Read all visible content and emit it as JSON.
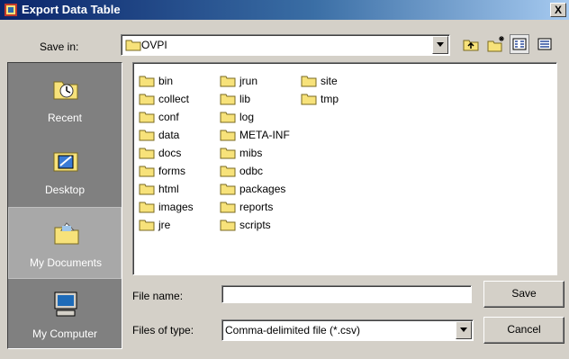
{
  "window": {
    "title": "Export Data Table",
    "close_label": "X"
  },
  "save_in": {
    "label": "Save in:",
    "value": "OVPI"
  },
  "toolbar": {
    "icons": [
      "up-one-level-icon",
      "create-new-folder-icon",
      "list-view-icon",
      "details-view-icon"
    ]
  },
  "places": [
    {
      "label": "Recent",
      "icon": "recent-clock-folder-icon"
    },
    {
      "label": "Desktop",
      "icon": "desktop-icon"
    },
    {
      "label": "My Documents",
      "icon": "my-documents-icon"
    },
    {
      "label": "My Computer",
      "icon": "my-computer-icon"
    }
  ],
  "files": {
    "col1": [
      "bin",
      "collect",
      "conf",
      "data",
      "docs",
      "forms",
      "html",
      "images",
      "jre"
    ],
    "col2": [
      "jrun",
      "lib",
      "log",
      "META-INF",
      "mibs",
      "odbc",
      "packages",
      "reports",
      "scripts"
    ],
    "col3": [
      "site",
      "tmp"
    ]
  },
  "file_name": {
    "label": "File name:",
    "value": ""
  },
  "file_type": {
    "label": "Files of type:",
    "value": "Comma-delimited file (*.csv)"
  },
  "buttons": {
    "save": "Save",
    "cancel": "Cancel"
  },
  "colors": {
    "title_start": "#0a246a",
    "title_end": "#a6caf0",
    "face": "#d4d0c8",
    "folder": "#f7e27a"
  }
}
